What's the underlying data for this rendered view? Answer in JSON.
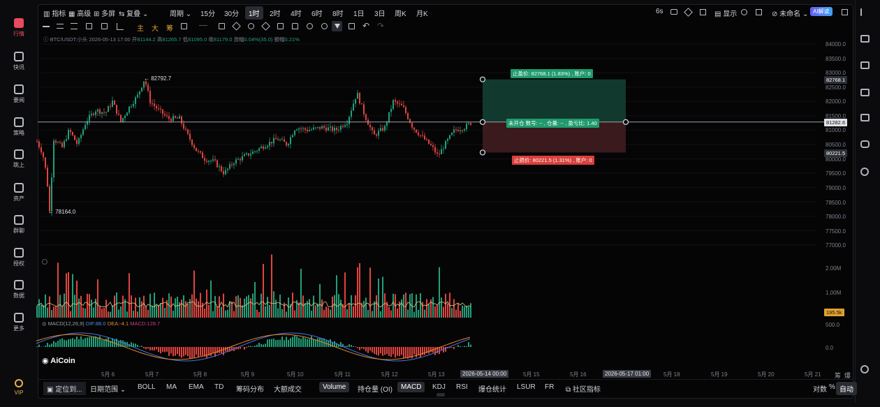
{
  "toolbar": {
    "indicator": "指标",
    "advanced": "高级",
    "multi": "多屏",
    "overlay": "复叠",
    "period": "周期",
    "timeframes": [
      "15分",
      "30分",
      "1时",
      "2时",
      "4时",
      "6时",
      "8时",
      "1日",
      "3日",
      "周K",
      "月K"
    ],
    "selected_timeframe": "1时",
    "refresh": "6s",
    "show": "显示",
    "unnamed": "未命名",
    "ai_label": "AI解读"
  },
  "draw_tools": {
    "labels": [
      "主",
      "大",
      "筹"
    ]
  },
  "ohlc": {
    "symbol": "BTC/USDT:小头",
    "datetime": "2026-05-13 17:00",
    "open_label": "开",
    "open": "81144.2",
    "high_label": "高",
    "high": "81265.7",
    "low_label": "低",
    "low": "81095.0",
    "close_label": "收",
    "close": "81179.0",
    "change_label": "涨幅",
    "change": "0.04%(35.0)",
    "amp_label": "振幅",
    "amp": "0.21%"
  },
  "price_axis": [
    "84000.0",
    "83500.0",
    "83000.0",
    "82500.0",
    "82000.0",
    "81500.0",
    "81000.0",
    "80500.0",
    "80000.0",
    "79500.0",
    "79000.0",
    "78500.0",
    "78000.0",
    "77500.0",
    "77000.0"
  ],
  "price_tags": {
    "tp": "82768.1",
    "current": "81282.6",
    "sl": "80221.5",
    "volume": "195.5k"
  },
  "annotations": {
    "high": "82792.7",
    "low": "78164.0",
    "take_profit": "止盈价: 82768.1 (1.83%) , 账户: 0",
    "position": "未开仓 数号: -- , 仓量: -- , 盈亏比: 1.40",
    "stop_loss": "止损价: 80221.5 (1.31%) , 账户: 0"
  },
  "volume_axis": [
    "2.00M",
    "1.00M"
  ],
  "macd": {
    "title": "MACD(12,26,9)",
    "dif": "DIF:88.0",
    "dea": "DEA:-4.1",
    "macd": "MACD:128.7",
    "axis": [
      "500.0",
      "0.0"
    ]
  },
  "date_axis": [
    "5月 6",
    "5月 7",
    "5月 8",
    "5月 9",
    "5月 10",
    "5月 11",
    "5月 12",
    "5月 13",
    "5月 15",
    "5月 16",
    "5月 18",
    "5月 19",
    "5月 20",
    "5月 21"
  ],
  "date_highlights": [
    "2026-05-14 00:00",
    "2026-05-17 01:00"
  ],
  "date_right": [
    "筹",
    "爆"
  ],
  "logo": "AiCoin",
  "bottom_bar": {
    "locate": "定位到...",
    "date_range": "日期范围",
    "indicators": [
      "BOLL",
      "MA",
      "EMA",
      "TD",
      "筹码分布",
      "大额成交"
    ],
    "sub_indicators": [
      "Volume",
      "持仓量 (OI)",
      "MACD",
      "KDJ",
      "RSI",
      "爆仓统计",
      "LSUR",
      "FR",
      "社区指标"
    ],
    "selected": [
      "Volume",
      "MACD"
    ],
    "right": [
      "对数",
      "%",
      "自动"
    ]
  },
  "left_nav": [
    "行情",
    "快讯",
    "要闻",
    "策略",
    "跳上",
    "资产",
    "群聊",
    "授权",
    "数据",
    "更多",
    "VIP"
  ],
  "colors": {
    "up": "#22a07a",
    "down": "#e0453f",
    "accent": "#e84a5f",
    "tp_zone": "#12392e",
    "sl_zone": "#3a1a1c"
  }
}
